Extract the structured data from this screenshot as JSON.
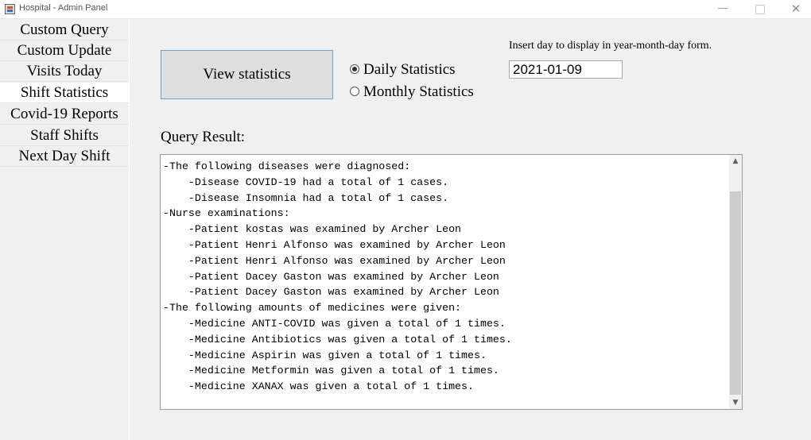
{
  "window": {
    "title": "Hospital - Admin Panel",
    "minimize": "—",
    "close": "✕"
  },
  "sidebar": {
    "items": [
      {
        "label": "Custom Query",
        "active": false
      },
      {
        "label": "Custom Update",
        "active": false
      },
      {
        "label": "Visits Today",
        "active": false
      },
      {
        "label": "Shift Statistics",
        "active": true
      },
      {
        "label": "Covid-19 Reports",
        "active": false
      },
      {
        "label": "Staff Shifts",
        "active": false
      },
      {
        "label": "Next Day Shift",
        "active": false
      }
    ]
  },
  "main": {
    "view_button": "View statistics",
    "radio_daily": "Daily Statistics",
    "radio_monthly": "Monthly Statistics",
    "selected_mode": "daily",
    "date_label": "Insert day to display in year-month-day form.",
    "date_value": "2021-01-09",
    "result_label": "Query Result:",
    "result_lines": [
      "-The following diseases were diagnosed:",
      "    -Disease COVID-19 had a total of 1 cases.",
      "    -Disease Insomnia had a total of 1 cases.",
      "-Nurse examinations:",
      "    -Patient kostas was examined by Archer Leon",
      "    -Patient Henri Alfonso was examined by Archer Leon",
      "    -Patient Henri Alfonso was examined by Archer Leon",
      "    -Patient Dacey Gaston was examined by Archer Leon",
      "    -Patient Dacey Gaston was examined by Archer Leon",
      "-The following amounts of medicines were given:",
      "    -Medicine ANTI-COVID was given a total of 1 times.",
      "    -Medicine Antibiotics was given a total of 1 times.",
      "    -Medicine Aspirin was given a total of 1 times.",
      "    -Medicine Metformin was given a total of 1 times.",
      "    -Medicine XANAX was given a total of 1 times."
    ]
  },
  "scrollbar": {
    "up_arrow": "▲",
    "down_arrow": "▼"
  }
}
